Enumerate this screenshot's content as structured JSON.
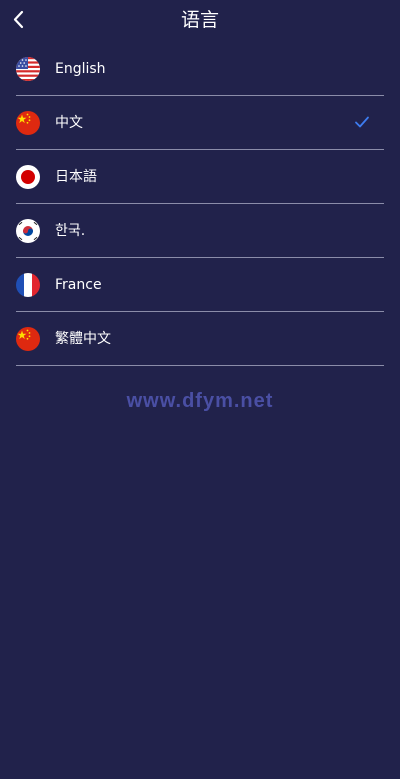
{
  "header": {
    "title": "语言",
    "back_icon": "chevron-left-icon"
  },
  "languages": [
    {
      "label": "English",
      "flag": "us-flag-icon",
      "selected": false
    },
    {
      "label": "中文",
      "flag": "cn-flag-icon",
      "selected": true
    },
    {
      "label": "日本語",
      "flag": "jp-flag-icon",
      "selected": false
    },
    {
      "label": "한국.",
      "flag": "kr-flag-icon",
      "selected": false
    },
    {
      "label": "France",
      "flag": "fr-flag-icon",
      "selected": false
    },
    {
      "label": "繁體中文",
      "flag": "cn-flag-icon",
      "selected": false
    }
  ],
  "selected_check_icon": "check-icon",
  "watermark": "www.dfym.net",
  "colors": {
    "background": "#21224b",
    "divider": "#8b8da9",
    "accent": "#3d7cf0",
    "watermark": "#4a4fa4"
  }
}
